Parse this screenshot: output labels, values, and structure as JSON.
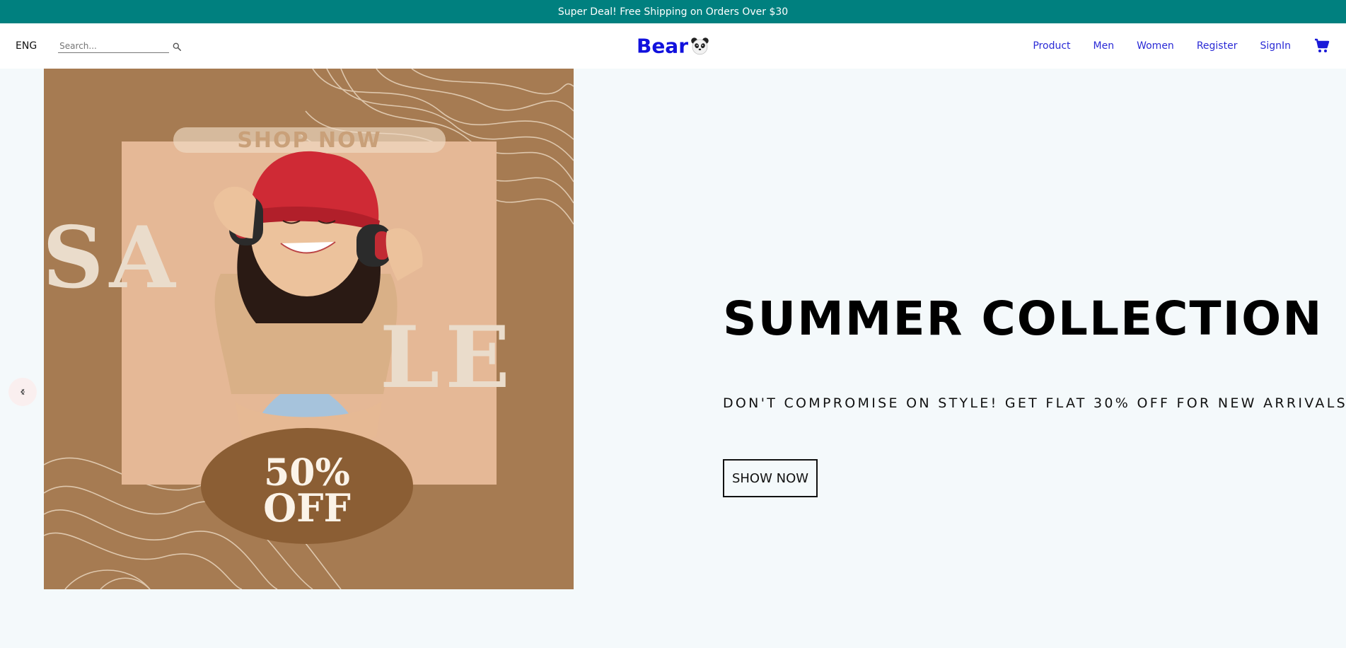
{
  "announcement": {
    "text": "Super Deal! Free Shipping on Orders Over $30"
  },
  "header": {
    "language": "ENG",
    "search": {
      "placeholder": "Search...",
      "value": ""
    },
    "logo": {
      "text": "Bear",
      "icon": "panda-icon"
    },
    "nav": {
      "product": "Product",
      "men": "Men",
      "women": "Women",
      "register": "Register",
      "signin": "SignIn"
    },
    "cart": {
      "icon": "cart-icon"
    }
  },
  "slider": {
    "prev_icon": "chevron-left-icon",
    "slide": {
      "image_text": {
        "top": "SHOP NOW",
        "word_1": "SA",
        "word_2": "LE",
        "badge_1": "50%",
        "badge_2": "OFF"
      },
      "title": "SUMMER COLLECTION",
      "description": "DON'T COMPROMISE ON STYLE! GET FLAT 30% OFF FOR NEW ARRIVALS.",
      "button": "SHOW NOW"
    }
  },
  "colors": {
    "announcement_bg": "#00807f",
    "nav_link": "#2a2ad6",
    "logo": "#1111dd",
    "hero_bg": "#f4f9fb",
    "slide_bg": "#a67b52"
  }
}
